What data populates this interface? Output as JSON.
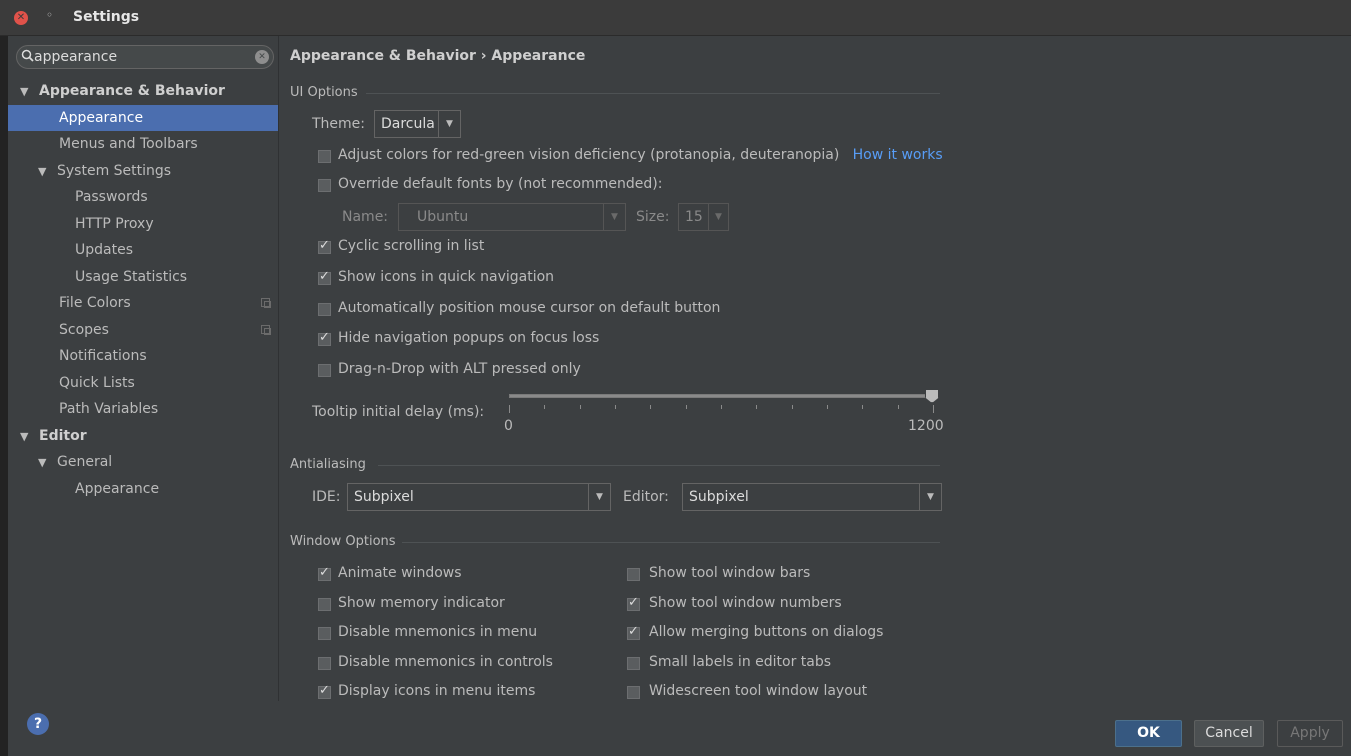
{
  "window": {
    "title": "Settings"
  },
  "search": {
    "value": "appearance",
    "placeholder": ""
  },
  "tree": [
    {
      "label": "Appearance & Behavior",
      "arrow": "▼",
      "level": 0,
      "bold": true
    },
    {
      "label": "Appearance",
      "level": 1,
      "selected": true
    },
    {
      "label": "Menus and Toolbars",
      "level": 1
    },
    {
      "label": "System Settings",
      "arrow": "▼",
      "level": 1
    },
    {
      "label": "Passwords",
      "level": 2
    },
    {
      "label": "HTTP Proxy",
      "level": 2
    },
    {
      "label": "Updates",
      "level": 2
    },
    {
      "label": "Usage Statistics",
      "level": 2
    },
    {
      "label": "File Colors",
      "level": 1,
      "copy": true
    },
    {
      "label": "Scopes",
      "level": 1,
      "copy": true
    },
    {
      "label": "Notifications",
      "level": 1
    },
    {
      "label": "Quick Lists",
      "level": 1
    },
    {
      "label": "Path Variables",
      "level": 1
    },
    {
      "label": "Editor",
      "arrow": "▼",
      "level": 0,
      "bold": true
    },
    {
      "label": "General",
      "arrow": "▼",
      "level": 1
    },
    {
      "label": "Appearance",
      "level": 2
    }
  ],
  "breadcrumb": "Appearance & Behavior › Appearance",
  "ui_options": {
    "title": "UI Options",
    "theme_label": "Theme:",
    "theme_value": "Darcula",
    "adjust_colors": {
      "label": "Adjust colors for red-green vision deficiency (protanopia, deuteranopia)",
      "checked": false
    },
    "how_it_works": "How it works",
    "override_fonts": {
      "label": "Override default fonts by (not recommended):",
      "checked": false
    },
    "name_label": "Name:",
    "name_value": "Ubuntu",
    "size_label": "Size:",
    "size_value": "15",
    "cyclic_scrolling": {
      "label": "Cyclic scrolling in list",
      "checked": true
    },
    "show_icons_nav": {
      "label": "Show icons in quick navigation",
      "checked": true
    },
    "auto_position_mouse": {
      "label": "Automatically position mouse cursor on default button",
      "checked": false
    },
    "hide_nav_popups": {
      "label": "Hide navigation popups on focus loss",
      "checked": true
    },
    "drag_n_drop": {
      "label": "Drag-n-Drop with ALT pressed only",
      "checked": false
    },
    "tooltip_label": "Tooltip initial delay (ms):",
    "tooltip_min": "0",
    "tooltip_max": "1200",
    "tooltip_value": 1200
  },
  "antialiasing": {
    "title": "Antialiasing",
    "ide_label": "IDE:",
    "ide_value": "Subpixel",
    "editor_label": "Editor:",
    "editor_value": "Subpixel"
  },
  "window_options": {
    "title": "Window Options",
    "left": [
      {
        "label": "Animate windows",
        "checked": true
      },
      {
        "label": "Show memory indicator",
        "checked": false
      },
      {
        "label": "Disable mnemonics in menu",
        "checked": false
      },
      {
        "label": "Disable mnemonics in controls",
        "checked": false
      },
      {
        "label": "Display icons in menu items",
        "checked": true
      }
    ],
    "right": [
      {
        "label": "Show tool window bars",
        "checked": false
      },
      {
        "label": "Show tool window numbers",
        "checked": true
      },
      {
        "label": "Allow merging buttons on dialogs",
        "checked": true
      },
      {
        "label": "Small labels in editor tabs",
        "checked": false
      },
      {
        "label": "Widescreen tool window layout",
        "checked": false
      }
    ]
  },
  "footer": {
    "help": "?",
    "ok": "OK",
    "cancel": "Cancel",
    "apply": "Apply"
  }
}
